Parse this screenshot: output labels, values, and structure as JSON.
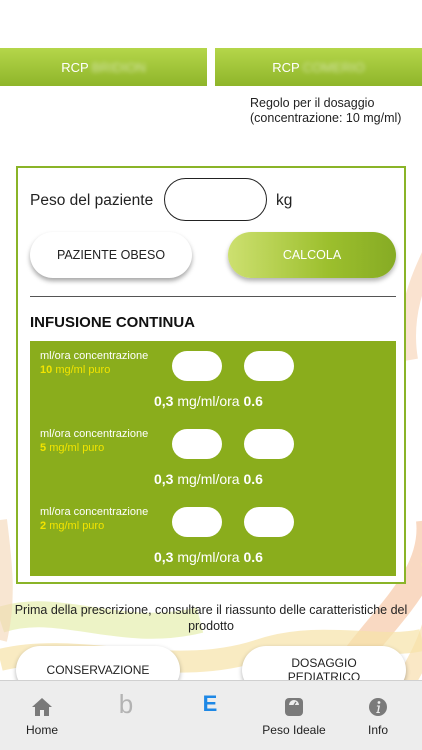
{
  "header": {
    "rcp_left_label": "RCP",
    "rcp_left_blur": "BRIDION",
    "rcp_right_label": "RCP",
    "rcp_right_blur": "COMERIO"
  },
  "dose_note": "Regolo per il dosaggio (concentrazione: 10 mg/ml)",
  "form": {
    "weight_label": "Peso del paziente",
    "weight_value": "",
    "weight_unit": "kg",
    "obese_button": "PAZIENTE OBESO",
    "calc_button": "CALCOLA"
  },
  "infusion": {
    "title": "INFUSIONE CONTINUA",
    "rows": [
      {
        "label": "ml/ora concentrazione",
        "conc": "10",
        "conc_unit": "mg/ml puro",
        "result_value": "0,3",
        "result_unit": "mg/ml/ora",
        "result_extra": "0.6"
      },
      {
        "label": "ml/ora concentrazione",
        "conc": "5",
        "conc_unit": "mg/ml puro",
        "result_value": "0,3",
        "result_unit": "mg/ml/ora",
        "result_extra": "0.6"
      },
      {
        "label": "ml/ora concentrazione",
        "conc": "2",
        "conc_unit": "mg/ml puro",
        "result_value": "0,3",
        "result_unit": "mg/ml/ora",
        "result_extra": "0.6"
      }
    ]
  },
  "disclaimer": "Prima della prescrizione, consultare il riassunto delle caratteristiche del prodotto",
  "buttons": {
    "conservation": "CONSERVAZIONE",
    "pediatric_line1": "DOSAGGIO",
    "pediatric_line2": "PEDIATRICO"
  },
  "tabbar": {
    "home": "Home",
    "tab_b": "b",
    "tab_e": "E",
    "ideal_weight": "Peso Ideale",
    "info": "Info"
  },
  "colors": {
    "brand_green": "#8aad1c",
    "highlight_yellow": "#f2e400",
    "active_tab_blue": "#1e88e5"
  }
}
